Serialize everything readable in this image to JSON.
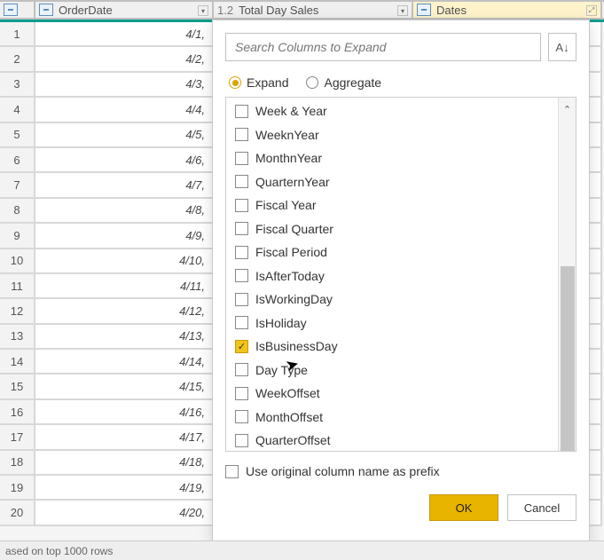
{
  "columns": {
    "col1": "OrderDate",
    "col2": "Total Day Sales",
    "col2_type": "1.2",
    "col3": "Dates"
  },
  "rows": [
    {
      "n": "1",
      "date": "4/1,"
    },
    {
      "n": "2",
      "date": "4/2,"
    },
    {
      "n": "3",
      "date": "4/3,"
    },
    {
      "n": "4",
      "date": "4/4,"
    },
    {
      "n": "5",
      "date": "4/5,"
    },
    {
      "n": "6",
      "date": "4/6,"
    },
    {
      "n": "7",
      "date": "4/7,"
    },
    {
      "n": "8",
      "date": "4/8,"
    },
    {
      "n": "9",
      "date": "4/9,"
    },
    {
      "n": "10",
      "date": "4/10,"
    },
    {
      "n": "11",
      "date": "4/11,"
    },
    {
      "n": "12",
      "date": "4/12,"
    },
    {
      "n": "13",
      "date": "4/13,"
    },
    {
      "n": "14",
      "date": "4/14,"
    },
    {
      "n": "15",
      "date": "4/15,"
    },
    {
      "n": "16",
      "date": "4/16,"
    },
    {
      "n": "17",
      "date": "4/17,"
    },
    {
      "n": "18",
      "date": "4/18,"
    },
    {
      "n": "19",
      "date": "4/19,"
    },
    {
      "n": "20",
      "date": "4/20,"
    }
  ],
  "status": "ased on top 1000 rows",
  "popup": {
    "search_placeholder": "Search Columns to Expand",
    "radio_expand": "Expand",
    "radio_aggregate": "Aggregate",
    "items": [
      {
        "label": "Week & Year",
        "checked": false
      },
      {
        "label": "WeeknYear",
        "checked": false
      },
      {
        "label": "MonthnYear",
        "checked": false
      },
      {
        "label": "QuarternYear",
        "checked": false
      },
      {
        "label": "Fiscal Year",
        "checked": false
      },
      {
        "label": "Fiscal Quarter",
        "checked": false
      },
      {
        "label": "Fiscal Period",
        "checked": false
      },
      {
        "label": "IsAfterToday",
        "checked": false
      },
      {
        "label": "IsWorkingDay",
        "checked": false
      },
      {
        "label": "IsHoliday",
        "checked": false
      },
      {
        "label": "IsBusinessDay",
        "checked": true
      },
      {
        "label": "Day Type",
        "checked": false
      },
      {
        "label": "WeekOffset",
        "checked": false
      },
      {
        "label": "MonthOffset",
        "checked": false
      },
      {
        "label": "QuarterOffset",
        "checked": false
      }
    ],
    "prefix_label": "Use original column name as prefix",
    "ok_label": "OK",
    "cancel_label": "Cancel"
  }
}
